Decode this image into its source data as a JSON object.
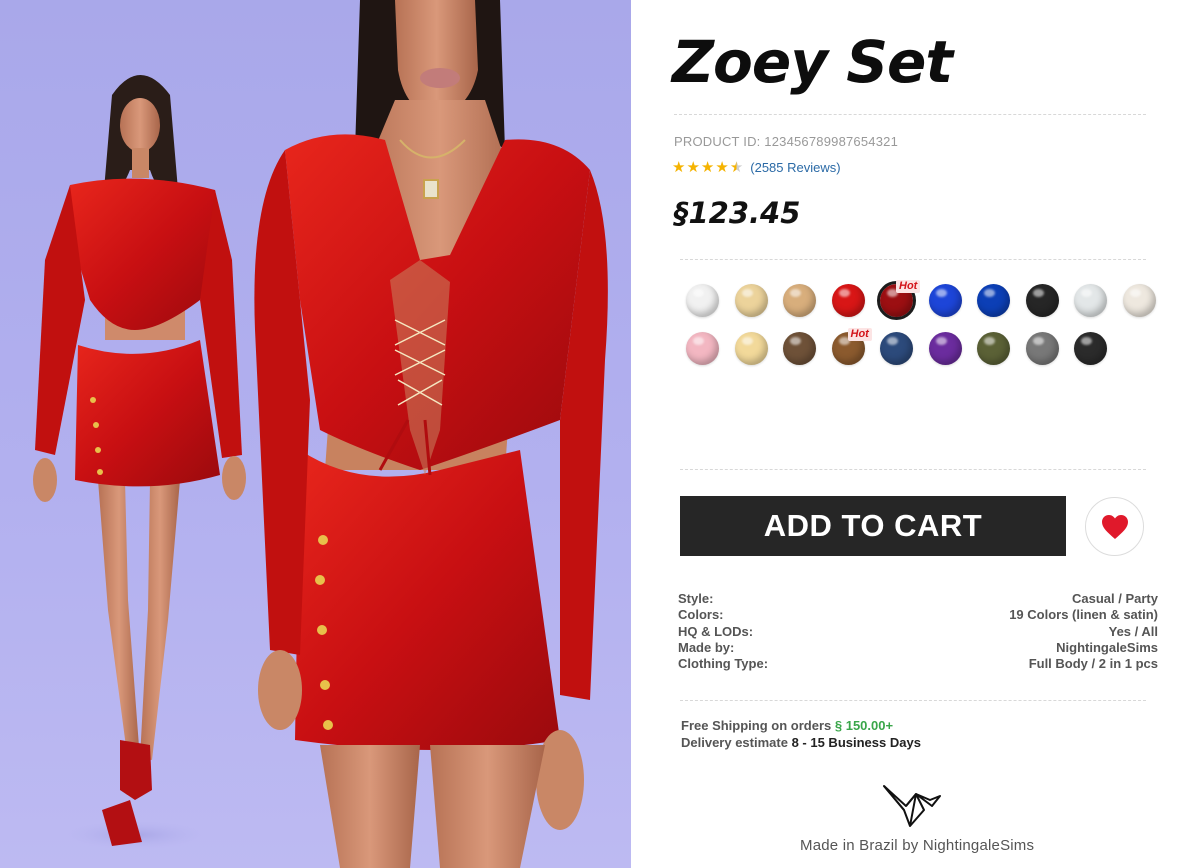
{
  "product": {
    "title": "Zoey Set",
    "product_id": "PRODUCT ID: 123456789987654321",
    "rating": 4.5,
    "reviews": "(2585 Reviews)",
    "price": "§123.45"
  },
  "swatches": [
    {
      "color": "#f1f1f1",
      "hot": false,
      "selected": false
    },
    {
      "color": "#ecd39b",
      "hot": false,
      "selected": false
    },
    {
      "color": "#d8ae7c",
      "hot": false,
      "selected": false
    },
    {
      "color": "#d81616",
      "hot": false,
      "selected": false
    },
    {
      "color": "#9c0f12",
      "hot": true,
      "selected": true
    },
    {
      "color": "#1d45d8",
      "hot": false,
      "selected": false
    },
    {
      "color": "#0c3fb6",
      "hot": false,
      "selected": false
    },
    {
      "color": "#262626",
      "hot": false,
      "selected": false
    },
    {
      "color": "#e3e7e8",
      "hot": false,
      "selected": false
    },
    {
      "color": "#eee8df",
      "hot": false,
      "selected": false
    },
    {
      "color": "#f3b7c2",
      "hot": false,
      "selected": false
    },
    {
      "color": "#f2d99a",
      "hot": false,
      "selected": false
    },
    {
      "color": "#6e5138",
      "hot": false,
      "selected": false
    },
    {
      "color": "#8b5a2e",
      "hot": true,
      "selected": false
    },
    {
      "color": "#2c4a7b",
      "hot": false,
      "selected": false
    },
    {
      "color": "#6b2c9e",
      "hot": false,
      "selected": false
    },
    {
      "color": "#5b6136",
      "hot": false,
      "selected": false
    },
    {
      "color": "#787878",
      "hot": false,
      "selected": false
    },
    {
      "color": "#2b2b2b",
      "hot": false,
      "selected": false
    }
  ],
  "hot_label": "Hot",
  "cart": {
    "label": "ADD TO CART"
  },
  "wishlist": {
    "icon": "heart-icon",
    "color": "#e0192b"
  },
  "specs": [
    {
      "label": "Style:",
      "value": "Casual / Party"
    },
    {
      "label": "Colors:",
      "value": "19 Colors (linen & satin)"
    },
    {
      "label": "HQ & LODs:",
      "value": "Yes / All"
    },
    {
      "label": "Made by:",
      "value": "NightingaleSims"
    },
    {
      "label": "Clothing Type:",
      "value": "Full Body / 2 in 1 pcs"
    }
  ],
  "shipping": {
    "free_text": "Free Shipping on orders",
    "free_amount": "§ 150.00+",
    "delivery_text": "Delivery estimate",
    "delivery_days": "8 - 15 Business Days"
  },
  "footer": {
    "text": "Made in Brazil by NightingaleSims",
    "logo_icon": "origami-bird-icon"
  },
  "colors": {
    "accent_green": "#3aa64a",
    "link_blue": "#2b6aa6",
    "star": "#f5b301",
    "button_bg": "#262626"
  }
}
